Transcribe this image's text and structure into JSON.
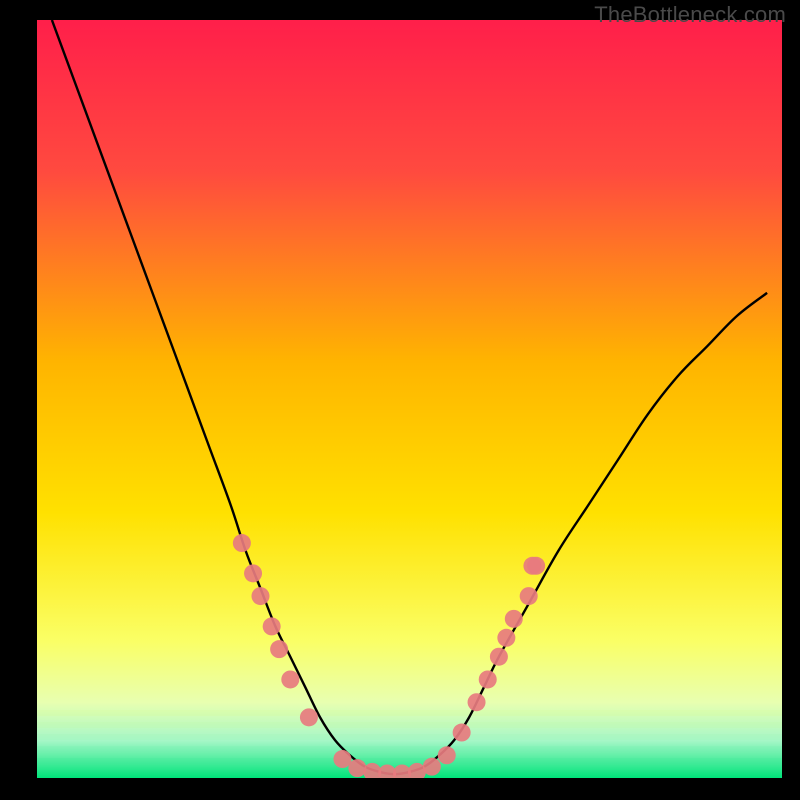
{
  "watermark": "TheBottleneck.com",
  "chart_data": {
    "type": "line",
    "title": "",
    "xlabel": "",
    "ylabel": "",
    "xlim": [
      0,
      100
    ],
    "ylim": [
      0,
      100
    ],
    "grid": false,
    "legend": false,
    "background_gradient": {
      "top": "#ff1f4a",
      "mid1": "#ffcf00",
      "mid2": "#f8ff7a",
      "bottom": "#00e47a"
    },
    "series": [
      {
        "name": "bottleneck-curve",
        "comment": "Approximate sampled points of the black V-shaped curve. y is percent of plot height from bottom.",
        "x": [
          2,
          5,
          8,
          11,
          14,
          17,
          20,
          23,
          26,
          28,
          30,
          32,
          34,
          36,
          38,
          40,
          42,
          44,
          46,
          48,
          50,
          52,
          54,
          56,
          58,
          60,
          62,
          66,
          70,
          74,
          78,
          82,
          86,
          90,
          94,
          98
        ],
        "y": [
          100,
          92,
          84,
          76,
          68,
          60,
          52,
          44,
          36,
          30,
          25,
          20,
          16,
          12,
          8,
          5,
          3,
          1.5,
          0.8,
          0.5,
          0.8,
          1.5,
          3,
          5,
          8,
          12,
          16,
          23,
          30,
          36,
          42,
          48,
          53,
          57,
          61,
          64
        ]
      }
    ],
    "markers": {
      "name": "highlighted-points",
      "color": "#e77b7f",
      "radius_px": 9,
      "comment": "Salmon dots along the curve. Same coordinate space (percent of plot).",
      "points": [
        {
          "x": 27.5,
          "y": 31
        },
        {
          "x": 29,
          "y": 27
        },
        {
          "x": 30,
          "y": 24
        },
        {
          "x": 31.5,
          "y": 20
        },
        {
          "x": 32.5,
          "y": 17
        },
        {
          "x": 34,
          "y": 13
        },
        {
          "x": 36.5,
          "y": 8
        },
        {
          "x": 41,
          "y": 2.5
        },
        {
          "x": 43,
          "y": 1.3
        },
        {
          "x": 45,
          "y": 0.8
        },
        {
          "x": 47,
          "y": 0.6
        },
        {
          "x": 49,
          "y": 0.6
        },
        {
          "x": 51,
          "y": 0.8
        },
        {
          "x": 53,
          "y": 1.5
        },
        {
          "x": 55,
          "y": 3
        },
        {
          "x": 57,
          "y": 6
        },
        {
          "x": 59,
          "y": 10
        },
        {
          "x": 60.5,
          "y": 13
        },
        {
          "x": 62,
          "y": 16
        },
        {
          "x": 63,
          "y": 18.5
        },
        {
          "x": 64,
          "y": 21
        },
        {
          "x": 66,
          "y": 24
        },
        {
          "x": 66.5,
          "y": 28
        },
        {
          "x": 67,
          "y": 28
        }
      ]
    }
  }
}
